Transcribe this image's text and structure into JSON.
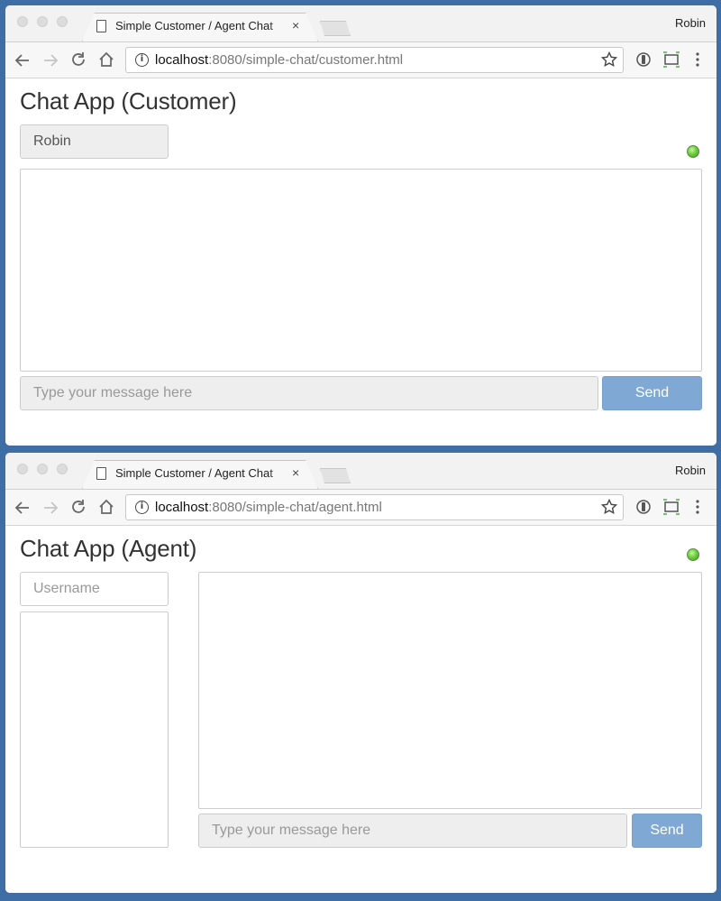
{
  "customer_window": {
    "tab_title": "Simple Customer / Agent Chat",
    "profile_name": "Robin",
    "url_host": "localhost",
    "url_path": ":8080/simple-chat/customer.html",
    "app_title": "Chat App (Customer)",
    "username_value": "Robin",
    "message_placeholder": "Type your message here",
    "send_label": "Send",
    "status_color": "#6fcf3e"
  },
  "agent_window": {
    "tab_title": "Simple Customer / Agent Chat",
    "profile_name": "Robin",
    "url_host": "localhost",
    "url_path": ":8080/simple-chat/agent.html",
    "app_title": "Chat App (Agent)",
    "username_placeholder": "Username",
    "message_placeholder": "Type your message here",
    "send_label": "Send",
    "status_color": "#6fcf3e"
  },
  "icons": {
    "tab_close": "×",
    "back": "back-arrow-icon",
    "forward": "forward-arrow-icon",
    "reload": "reload-icon",
    "home": "home-icon",
    "bookmark": "star-icon",
    "extension": "extension-icon",
    "cast": "cast-icon",
    "menu": "kebab-menu-icon"
  },
  "colors": {
    "send_button": "#7fa9d4",
    "desktop": "#3f6ea6"
  }
}
